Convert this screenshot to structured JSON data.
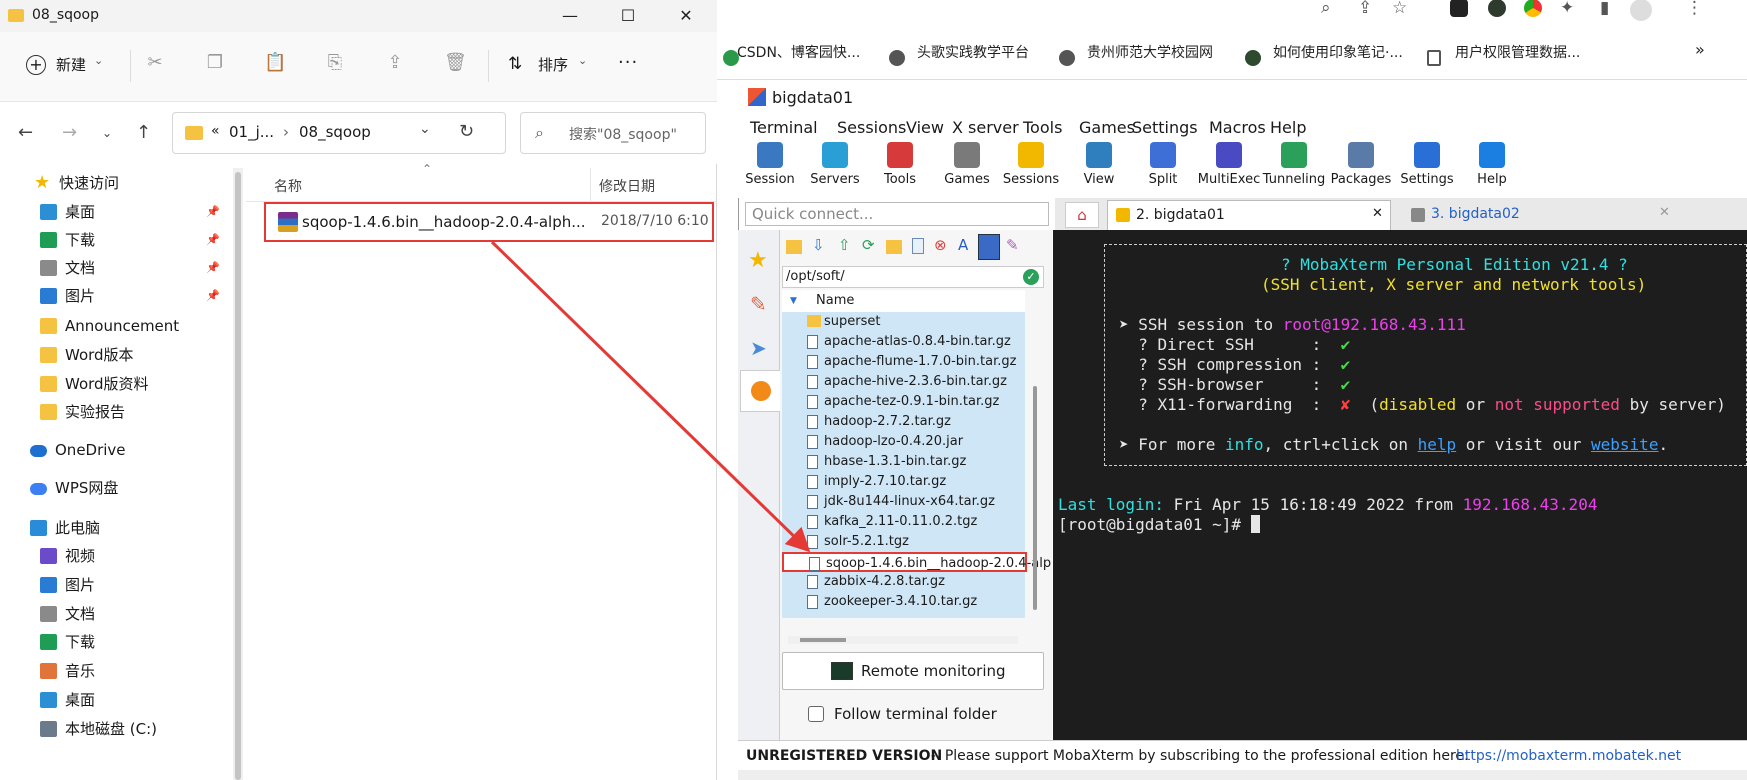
{
  "explorer": {
    "title": "08_sqoop",
    "toolbar": {
      "new_label": "新建",
      "sort_label": "排序",
      "more_label": "···"
    },
    "address": {
      "prefix": "«",
      "parent": "01_j...",
      "sep": "›",
      "current": "08_sqoop"
    },
    "search": {
      "placeholder": "搜索\"08_sqoop\""
    },
    "nav": [
      {
        "label": "快速访问",
        "icon": "star-icon",
        "color": "#f2b800",
        "pin": false
      },
      {
        "label": "桌面",
        "icon": "desktop-icon",
        "color": "#2b8fd6",
        "pin": true
      },
      {
        "label": "下载",
        "icon": "download-icon",
        "color": "#1f9d55",
        "pin": true
      },
      {
        "label": "文档",
        "icon": "document-icon",
        "color": "#8a8a8a",
        "pin": true
      },
      {
        "label": "图片",
        "icon": "pictures-icon",
        "color": "#2a7bd4",
        "pin": true
      },
      {
        "label": "Announcement",
        "icon": "folder-icon",
        "color": "#f5c242",
        "pin": false
      },
      {
        "label": "Word版本",
        "icon": "folder-icon",
        "color": "#f5c242",
        "pin": false
      },
      {
        "label": "Word版资料",
        "icon": "folder-icon",
        "color": "#f5c242",
        "pin": false
      },
      {
        "label": "实验报告",
        "icon": "folder-icon",
        "color": "#f5c242",
        "pin": false
      },
      {
        "label": "OneDrive",
        "icon": "cloud-icon",
        "color": "#1e6fd0",
        "pin": false
      },
      {
        "label": "WPS网盘",
        "icon": "cloud-icon",
        "color": "#3d7ff2",
        "pin": false
      },
      {
        "label": "此电脑",
        "icon": "computer-icon",
        "color": "#2a8bd8",
        "pin": false
      },
      {
        "label": "视频",
        "icon": "video-icon",
        "color": "#6a4bc9",
        "pin": false
      },
      {
        "label": "图片",
        "icon": "pictures-icon",
        "color": "#2a7bd4",
        "pin": false
      },
      {
        "label": "文档",
        "icon": "document-icon",
        "color": "#8a8a8a",
        "pin": false
      },
      {
        "label": "下载",
        "icon": "download-icon",
        "color": "#1f9d55",
        "pin": false
      },
      {
        "label": "音乐",
        "icon": "music-icon",
        "color": "#e0743a",
        "pin": false
      },
      {
        "label": "桌面",
        "icon": "desktop-icon",
        "color": "#2b8fd6",
        "pin": false
      },
      {
        "label": "本地磁盘 (C:)",
        "icon": "drive-icon",
        "color": "#6b7b8c",
        "pin": false
      }
    ],
    "columns": {
      "name": "名称",
      "modified": "修改日期"
    },
    "file": {
      "name": "sqoop-1.4.6.bin__hadoop-2.0.4-alph...",
      "date": "2018/7/10 6:10"
    }
  },
  "browser": {
    "bookmarks": [
      "CSDN、博客园快...",
      "头歌实践教学平台",
      "贵州师范大学校园网",
      "如何使用印象笔记·...",
      "用户权限管理数据..."
    ],
    "more": "»"
  },
  "moba": {
    "title": "bigdata01",
    "menu": [
      "Terminal",
      "Sessions",
      "View",
      "X server",
      "Tools",
      "Games",
      "Settings",
      "Macros",
      "Help"
    ],
    "tools": [
      {
        "label": "Session",
        "color": "#3a78c2"
      },
      {
        "label": "Servers",
        "color": "#2a9fd6"
      },
      {
        "label": "Tools",
        "color": "#d63a3a"
      },
      {
        "label": "Games",
        "color": "#7a7a7a"
      },
      {
        "label": "Sessions",
        "color": "#f2b800"
      },
      {
        "label": "View",
        "color": "#2f7fbf"
      },
      {
        "label": "Split",
        "color": "#3d6fd6"
      },
      {
        "label": "MultiExec",
        "color": "#4a4ac2"
      },
      {
        "label": "Tunneling",
        "color": "#2aa05a"
      },
      {
        "label": "Packages",
        "color": "#5a7aa8"
      },
      {
        "label": "Settings",
        "color": "#2a6fd6"
      },
      {
        "label": "Help",
        "color": "#1a7fe0"
      }
    ],
    "quick_connect": "Quick connect...",
    "tabs": [
      {
        "label": "2. bigdata01",
        "active": true
      },
      {
        "label": "3. bigdata02",
        "active": false
      }
    ],
    "sftp": {
      "path": "/opt/soft/",
      "header": "Name",
      "files": [
        "superset",
        "apache-atlas-0.8.4-bin.tar.gz",
        "apache-flume-1.7.0-bin.tar.gz",
        "apache-hive-2.3.6-bin.tar.gz",
        "apache-tez-0.9.1-bin.tar.gz",
        "hadoop-2.7.2.tar.gz",
        "hadoop-lzo-0.4.20.jar",
        "hbase-1.3.1-bin.tar.gz",
        "imply-2.7.10.tar.gz",
        "jdk-8u144-linux-x64.tar.gz",
        "kafka_2.11-0.11.0.2.tgz",
        "solr-5.2.1.tgz",
        "sqoop-1.4.6.bin__hadoop-2.0.4-alp",
        "zabbix-4.2.8.tar.gz",
        "zookeeper-3.4.10.tar.gz"
      ],
      "remote_monitoring": "Remote monitoring",
      "follow_label": "Follow terminal folder"
    },
    "terminal": {
      "banner1": "? MobaXterm Personal Edition v21.4 ?",
      "banner2": "(SSH client, X server and network tools)",
      "ssh_prefix": "➤ SSH session to ",
      "ssh_host": "root@192.168.43.111",
      "direct": "  ? Direct SSH      :  ",
      "compress": "  ? SSH compression :  ",
      "browser": "  ? SSH-browser     :  ",
      "x11": "  ? X11-forwarding  :  ",
      "check": "✔",
      "cross": "✘",
      "x11_note_a": "  (",
      "disabled": "disabled",
      "x11_note_b": " or ",
      "not_supported": "not supported",
      "x11_note_c": " by server)",
      "more_a": "➤ For more ",
      "info": "info",
      "more_b": ", ctrl+click on ",
      "help": "help",
      "more_c": " or visit our ",
      "website": "website",
      "more_d": ".",
      "last_login_label": "Last login:",
      "last_login_text": " Fri Apr 15 16:18:49 2022 from ",
      "last_login_ip": "192.168.43.204",
      "prompt": "[root@bigdata01 ~]# "
    },
    "status": {
      "bold": "UNREGISTERED VERSION",
      "text": "  -  Please support MobaXterm by subscribing to the professional edition here:  ",
      "link": "https://mobaxterm.mobatek.net"
    }
  }
}
